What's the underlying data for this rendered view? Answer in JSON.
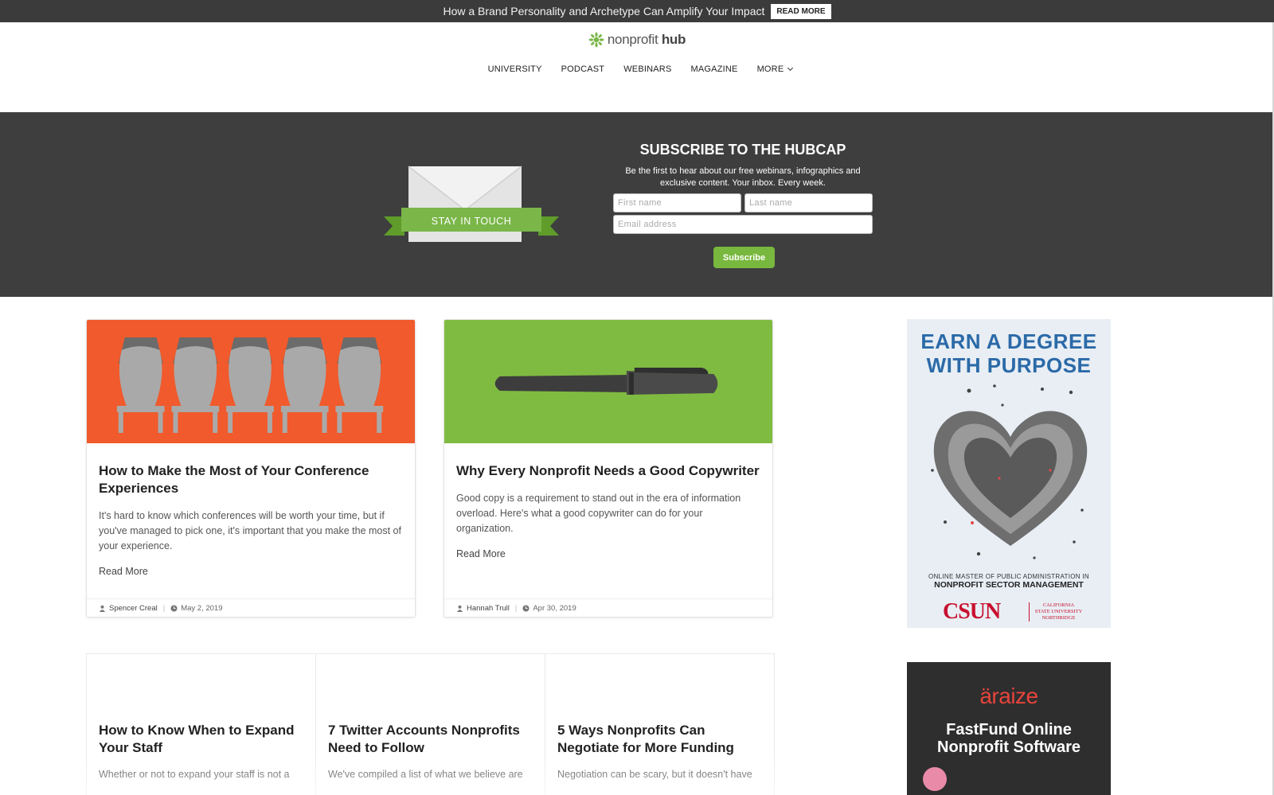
{
  "announcement": {
    "text": "How a Brand Personality and Archetype Can Amplify Your Impact",
    "button_label": "READ MORE"
  },
  "brand": {
    "name_light": "nonprofit",
    "name_bold": "hub",
    "icon": "leaf-sunburst-icon",
    "color": "#7ab648"
  },
  "nav": {
    "items": [
      {
        "label": "UNIVERSITY"
      },
      {
        "label": "PODCAST"
      },
      {
        "label": "WEBINARS"
      },
      {
        "label": "MAGAZINE"
      },
      {
        "label": "MORE"
      }
    ]
  },
  "subscribe": {
    "banner_label": "STAY IN TOUCH",
    "title": "SUBSCRIBE TO THE HUBCAP",
    "description": "Be the first to hear about our free webinars, infographics and exclusive content. Your inbox. Every week.",
    "first_name_placeholder": "First name",
    "last_name_placeholder": "Last name",
    "email_placeholder": "Email address",
    "button_label": "Subscribe",
    "accent": "#78b83e"
  },
  "featured": [
    {
      "title": "How to Make the Most of Your Conference Experiences",
      "excerpt": "It's hard to know which conferences will be worth your time, but if you've managed to pick one, it's important that you make the most of your experience.",
      "read_more": "Read More",
      "author": "Spencer Creal",
      "date": "May 2, 2019",
      "image_bg": "#f05a2c"
    },
    {
      "title": "Why Every Nonprofit Needs a Good Copywriter",
      "excerpt": "Good copy is a requirement to stand out in the era of information overload. Here's what a good copywriter can do for your organization.",
      "read_more": "Read More",
      "author": "Hannah Trull",
      "date": "Apr 30, 2019",
      "image_bg": "#7fbb41"
    }
  ],
  "secondary": [
    {
      "title": "How to Know When to Expand Your Staff",
      "excerpt": "Whether or not to expand your staff is not a"
    },
    {
      "title": "7 Twitter Accounts Nonprofits Need to Follow",
      "excerpt": "We've compiled a list of what we believe are"
    },
    {
      "title": "5 Ways Nonprofits Can Negotiate for More Funding",
      "excerpt": "Negotiation can be scary, but it doesn't have"
    }
  ],
  "ads": {
    "csun": {
      "headline_1": "EARN A DEGREE",
      "headline_2": "WITH PURPOSE",
      "sub_1": "ONLINE MASTER OF PUBLIC ADMINISTRATION IN",
      "sub_2": "NONPROFIT SECTOR MANAGEMENT",
      "logo": "CSUN",
      "university_1": "CALIFORNIA",
      "university_2": "STATE UNIVERSITY",
      "university_3": "NORTHRIDGE"
    },
    "araize": {
      "logo": "äraize",
      "headline_1": "FastFund Online",
      "headline_2": "Nonprofit Software"
    }
  }
}
